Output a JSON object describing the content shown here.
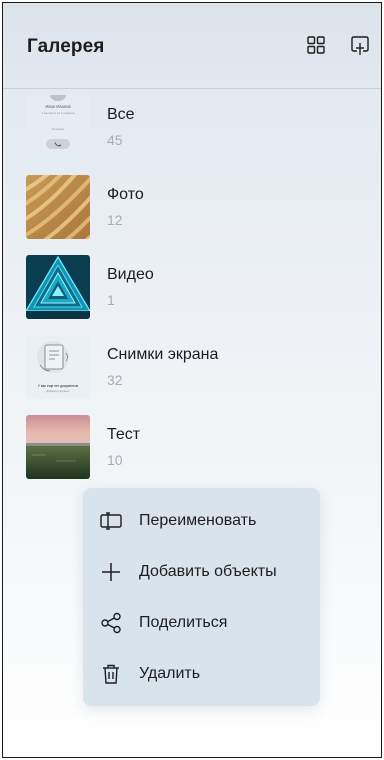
{
  "header": {
    "title": "Галерея",
    "grid_icon": "grid-view-icon",
    "new_album_icon": "new-album-icon"
  },
  "albums": [
    {
      "name": "Все",
      "count": "45",
      "thumb_text": {
        "line1": "Иван Иванов",
        "line2": "4 контакта из 1 раздела",
        "line3": "Телефон"
      }
    },
    {
      "name": "Фото",
      "count": "12"
    },
    {
      "name": "Видео",
      "count": "1"
    },
    {
      "name": "Снимки экрана",
      "count": "32",
      "thumb_text": {
        "line1": "У вас еще нет документов",
        "line2": "Добавьте документ"
      }
    },
    {
      "name": "Тест",
      "count": "10"
    }
  ],
  "context_menu": {
    "items": [
      {
        "label": "Переименовать",
        "icon": "rename-icon"
      },
      {
        "label": "Добавить объекты",
        "icon": "plus-icon"
      },
      {
        "label": "Поделиться",
        "icon": "share-icon"
      },
      {
        "label": "Удалить",
        "icon": "trash-icon"
      }
    ]
  },
  "colors": {
    "background_top": "#dfe6ee",
    "menu_background": "#d8e3ec",
    "text_primary": "#1d1d1f",
    "text_secondary": "#a6adb5"
  }
}
